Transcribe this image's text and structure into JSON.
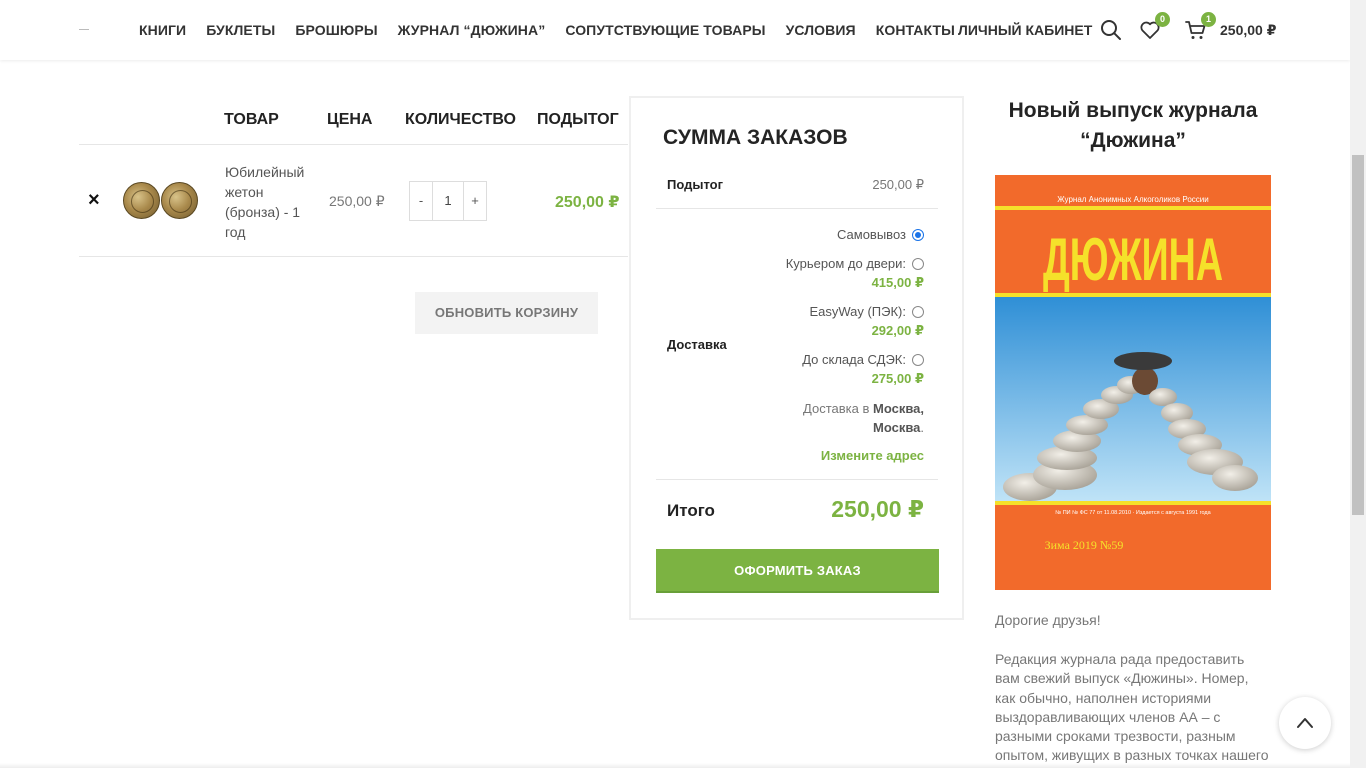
{
  "header": {
    "nav": [
      "КНИГИ",
      "БУКЛЕТЫ",
      "БРОШЮРЫ",
      "ЖУРНАЛ “ДЮЖИНА”",
      "СОПУТСТВУЮЩИЕ ТОВАРЫ",
      "УСЛОВИЯ",
      "КОНТАКТЫ"
    ],
    "account": "ЛИЧНЫЙ КАБИНЕТ",
    "wishlist_count": "0",
    "cart_count": "1",
    "cart_total": "250,00 ₽"
  },
  "cart": {
    "columns": {
      "product": "ТОВАР",
      "price": "ЦЕНА",
      "quantity": "КОЛИЧЕСТВО",
      "subtotal": "ПОДЫТОГ"
    },
    "items": [
      {
        "remove": "×",
        "name": "Юбилейный жетон (бронза) - 1 год",
        "price": "250,00 ₽",
        "quantity": "1",
        "minus": "-",
        "plus": "+",
        "subtotal": "250,00 ₽"
      }
    ],
    "update_button": "ОБНОВИТЬ КОРЗИНУ"
  },
  "summary": {
    "title": "СУММА ЗАКАЗОВ",
    "subtotal_label": "Подытог",
    "subtotal_value": "250,00 ₽",
    "shipping_label": "Доставка",
    "shipping_options": [
      {
        "label": "Самовывоз",
        "price": "",
        "checked": true
      },
      {
        "label": "Курьером до двери:",
        "price": "415,00 ₽",
        "checked": false
      },
      {
        "label": "EasyWay (ПЭК):",
        "price": "292,00 ₽",
        "checked": false
      },
      {
        "label": "До склада СДЭК:",
        "price": "275,00 ₽",
        "checked": false
      }
    ],
    "destination_prefix": "Доставка в",
    "destination_city": "Москва,",
    "destination_region": "Москва",
    "destination_suffix": ".",
    "change_address": "Измените адрес",
    "total_label": "Итого",
    "total_value": "250,00 ₽",
    "checkout_button": "ОФОРМИТЬ ЗАКАЗ"
  },
  "sidebar": {
    "title": "Новый выпуск журнала “Дюжина”",
    "cover": {
      "top_line": "Журнал Анонимных Алкоголиков России",
      "masthead": "ДЮЖИНА",
      "registration": "№ ПИ № ФС 77 от 11.08.2010 · Издается с августа 1991 года",
      "issue": "Зима 2019  №59"
    },
    "greeting": "Дорогие друзья!",
    "body": "Редакция журнала рада предоставить вам свежий выпуск «Дюжины». Номер, как обычно, наполнен историями выздоравливающих членов АА – с разными сроками трезвости, разным опытом, живущих в разных точках нашего"
  },
  "colors": {
    "accent": "#7cb342",
    "cover_orange": "#f26a2b",
    "cover_yellow": "#f5e12a"
  }
}
